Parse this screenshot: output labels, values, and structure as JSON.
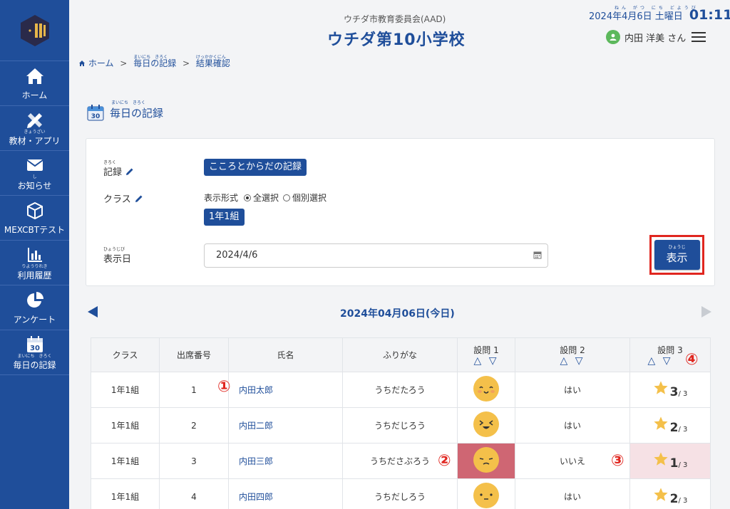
{
  "sidebar": {
    "items": [
      {
        "label": "ホーム",
        "ruby": "",
        "icon": "home-icon"
      },
      {
        "label": "教材・アプリ",
        "ruby": "きょうざい",
        "icon": "pencil-ruler-icon"
      },
      {
        "label": "お知らせ",
        "ruby": "し",
        "icon": "mail-icon"
      },
      {
        "label": "MEXCBTテスト",
        "ruby": "",
        "icon": "cube-icon"
      },
      {
        "label": "利用履歴",
        "ruby": "りようりれき",
        "icon": "bar-chart-icon"
      },
      {
        "label": "アンケート",
        "ruby": "",
        "icon": "pie-chart-icon"
      },
      {
        "label": "毎日の記録",
        "ruby": "まいにち　きろく",
        "icon": "calendar-icon",
        "calendar_day": "30"
      }
    ]
  },
  "header": {
    "org": "ウチダ市教育委員会(AAD)",
    "school": "ウチダ第10小学校",
    "date": "2024年4月6日 土曜日",
    "date_ruby": "ねん がつ にち どようび",
    "time": "01:11",
    "user": "内田 洋美 さん"
  },
  "breadcrumb": {
    "home": "ホーム",
    "daily": "毎日の記録",
    "daily_ruby": "まいにち　きろく",
    "result": "結果確認",
    "result_ruby": "けっかかくにん",
    "sep": ">"
  },
  "page": {
    "title": "毎日の記録",
    "title_ruby": "まいにち　きろく",
    "calendar_day": "30"
  },
  "form": {
    "record_label": "記録",
    "record_ruby": "きろく",
    "record_value": "こころとからだの記録",
    "class_label": "クラス",
    "display_format_label": "表示形式",
    "option_all": "全選択",
    "option_individual": "個別選択",
    "class_value": "1年1組",
    "date_label": "表示日",
    "date_ruby": "ひょうじび",
    "date_value": "2024/4/6",
    "show_button": "表示",
    "show_button_ruby": "ひょうじ"
  },
  "day_nav": {
    "title": "2024年04月06日(今日)"
  },
  "table": {
    "headers": [
      "クラス",
      "出席番号",
      "氏名",
      "ふりがな",
      "設問 1",
      "設問 2",
      "設問 3"
    ],
    "sort_glyph": "△ ▽",
    "rows": [
      {
        "class": "1年1組",
        "num": "1",
        "name": "内田太郎",
        "kana": "うちだたろう",
        "q2": "はい",
        "q3": "3",
        "q3_max": "/ 3"
      },
      {
        "class": "1年1組",
        "num": "2",
        "name": "内田二郎",
        "kana": "うちだじろう",
        "q2": "はい",
        "q3": "2",
        "q3_max": "/ 3"
      },
      {
        "class": "1年1組",
        "num": "3",
        "name": "内田三郎",
        "kana": "うちださぶろう",
        "q2": "いいえ",
        "q3": "1",
        "q3_max": "/ 3"
      },
      {
        "class": "1年1組",
        "num": "4",
        "name": "内田四郎",
        "kana": "うちだしろう",
        "q2": "はい",
        "q3": "2",
        "q3_max": "/ 3"
      }
    ]
  },
  "markers": [
    "①",
    "②",
    "③",
    "④"
  ],
  "colors": {
    "brand": "#1f4e9a",
    "highlight": "#e0261f",
    "face": "#f4c04a",
    "alert_cell": "#cf6673",
    "alert_soft": "#f6e1e5"
  }
}
